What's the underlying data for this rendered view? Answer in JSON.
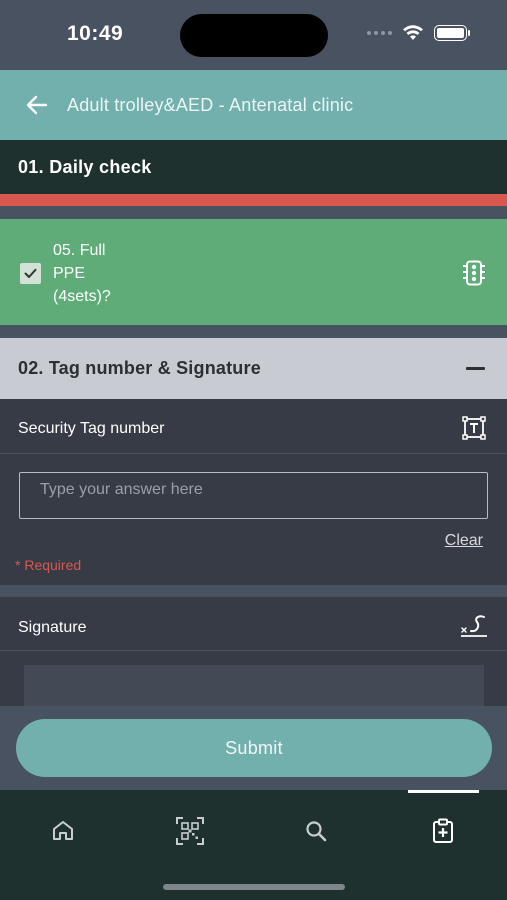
{
  "status_bar": {
    "time": "10:49"
  },
  "header": {
    "title": "Adult trolley&AED - Antenatal clinic"
  },
  "section1": {
    "title": "01. Daily check",
    "item": {
      "line1": "05. Full",
      "line2": "PPE",
      "line3": "(4sets)?",
      "checked": true
    }
  },
  "section2": {
    "title": "02. Tag number & Signature",
    "security_tag": {
      "label": "Security Tag number",
      "placeholder": "Type your answer here",
      "clear_label": "Clear",
      "required_label": "* Required"
    },
    "signature": {
      "label": "Signature"
    }
  },
  "submit_label": "Submit",
  "bottom_nav": {
    "items": [
      "home",
      "qr-scan",
      "search",
      "checklist"
    ],
    "active": "checklist"
  },
  "colors": {
    "accent": "#71b0ad",
    "dark_header": "#1f312f",
    "alert_red": "#d8584f",
    "success_green": "#5fac79",
    "panel": "#363b45",
    "background": "#485261"
  }
}
